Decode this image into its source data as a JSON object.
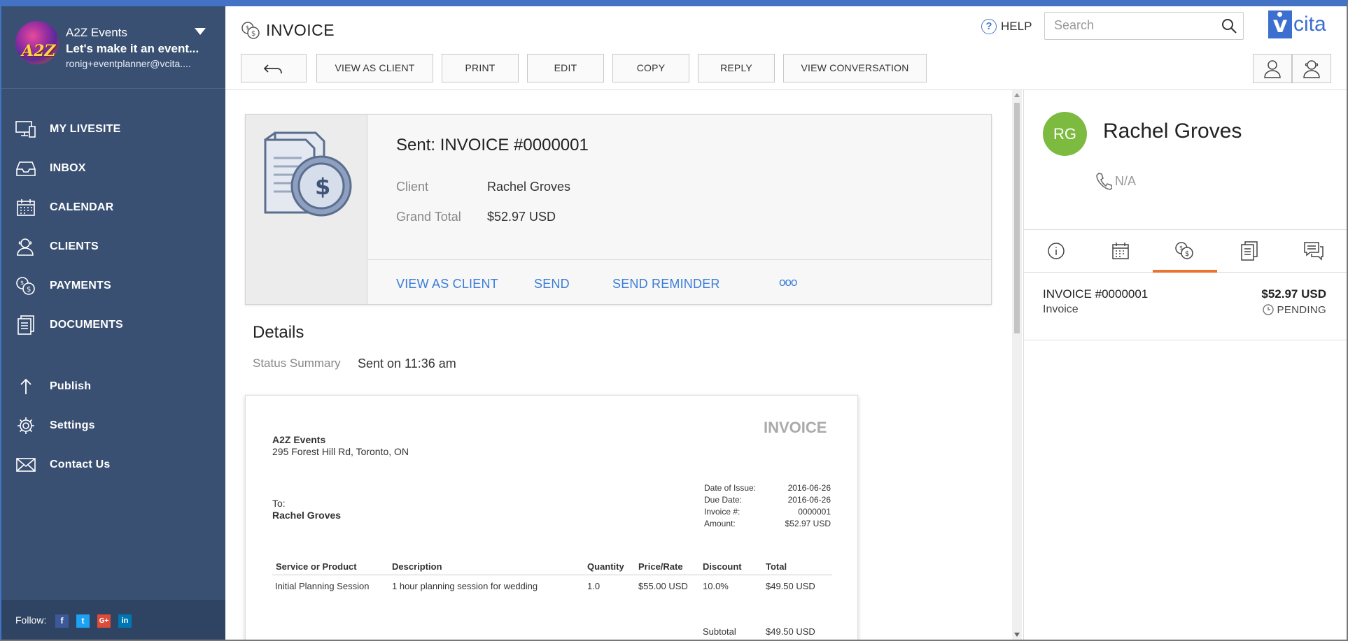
{
  "account": {
    "name": "A2Z Events",
    "tagline": "Let's make it an event...",
    "email": "ronig+eventplanner@vcita....",
    "logo_text": "A2Z"
  },
  "sidebar": {
    "items": [
      {
        "label": "MY LIVESITE",
        "icon": "monitor-icon"
      },
      {
        "label": "INBOX",
        "icon": "inbox-icon"
      },
      {
        "label": "CALENDAR",
        "icon": "calendar-icon"
      },
      {
        "label": "CLIENTS",
        "icon": "clients-icon"
      },
      {
        "label": "PAYMENTS",
        "icon": "payments-icon"
      },
      {
        "label": "DOCUMENTS",
        "icon": "documents-icon"
      },
      {
        "label": "Publish",
        "icon": "publish-icon"
      },
      {
        "label": "Settings",
        "icon": "gear-icon"
      },
      {
        "label": "Contact Us",
        "icon": "envelope-icon"
      }
    ],
    "follow_label": "Follow:",
    "social": [
      {
        "name": "facebook",
        "glyph": "f",
        "color": "#3b5998"
      },
      {
        "name": "twitter",
        "glyph": "t",
        "color": "#1da1f2"
      },
      {
        "name": "googleplus",
        "glyph": "G+",
        "color": "#dd4b39"
      },
      {
        "name": "linkedin",
        "glyph": "in",
        "color": "#0077b5"
      }
    ]
  },
  "header": {
    "title": "INVOICE",
    "help_label": "HELP",
    "search_placeholder": "Search",
    "brand": "cita",
    "brand_letter": "v",
    "toolbar": {
      "view_as_client": "VIEW AS CLIENT",
      "print": "PRINT",
      "edit": "EDIT",
      "copy": "COPY",
      "reply": "REPLY",
      "view_conversation": "VIEW CONVERSATION"
    }
  },
  "summary": {
    "title": "Sent: INVOICE #0000001",
    "client_label": "Client",
    "client_value": "Rachel Groves",
    "total_label": "Grand Total",
    "total_value": "$52.97 USD",
    "actions": {
      "view_as_client": "VIEW AS CLIENT",
      "send": "SEND",
      "send_reminder": "SEND REMINDER",
      "more": "ooo"
    }
  },
  "details": {
    "heading": "Details",
    "status_label": "Status Summary",
    "status_value": "Sent on 11:36 am"
  },
  "invoice_doc": {
    "title": "INVOICE",
    "business_name": "A2Z Events",
    "business_address": "295 Forest Hill Rd, Toronto, ON",
    "to_label": "To:",
    "to_name": "Rachel Groves",
    "meta": [
      {
        "label": "Date of Issue:",
        "value": "2016-06-26"
      },
      {
        "label": "Due Date:",
        "value": "2016-06-26"
      },
      {
        "label": "Invoice #:",
        "value": "0000001"
      },
      {
        "label": "Amount:",
        "value": "$52.97 USD"
      }
    ],
    "columns": [
      "Service or Product",
      "Description",
      "Quantity",
      "Price/Rate",
      "Discount",
      "Total"
    ],
    "rows": [
      [
        "Initial Planning Session",
        "1 hour planning session for wedding",
        "1.0",
        "$55.00 USD",
        "10.0%",
        "$49.50 USD"
      ]
    ],
    "subtotal_label": "Subtotal",
    "subtotal_value": "$49.50 USD"
  },
  "client_panel": {
    "initials": "RG",
    "name": "Rachel Groves",
    "phone": "N/A",
    "avatar_color": "#7cbb3f",
    "tabs": [
      "info-icon",
      "calendar-icon",
      "payments-icon",
      "documents-icon",
      "messages-icon"
    ],
    "active_tab": 2,
    "item": {
      "number": "INVOICE #0000001",
      "type": "Invoice",
      "amount": "$52.97 USD",
      "status": "PENDING"
    }
  },
  "colors": {
    "sidebar": "#3a5073",
    "accent_blue": "#3b7dd8",
    "active_tab": "#e8742f"
  }
}
